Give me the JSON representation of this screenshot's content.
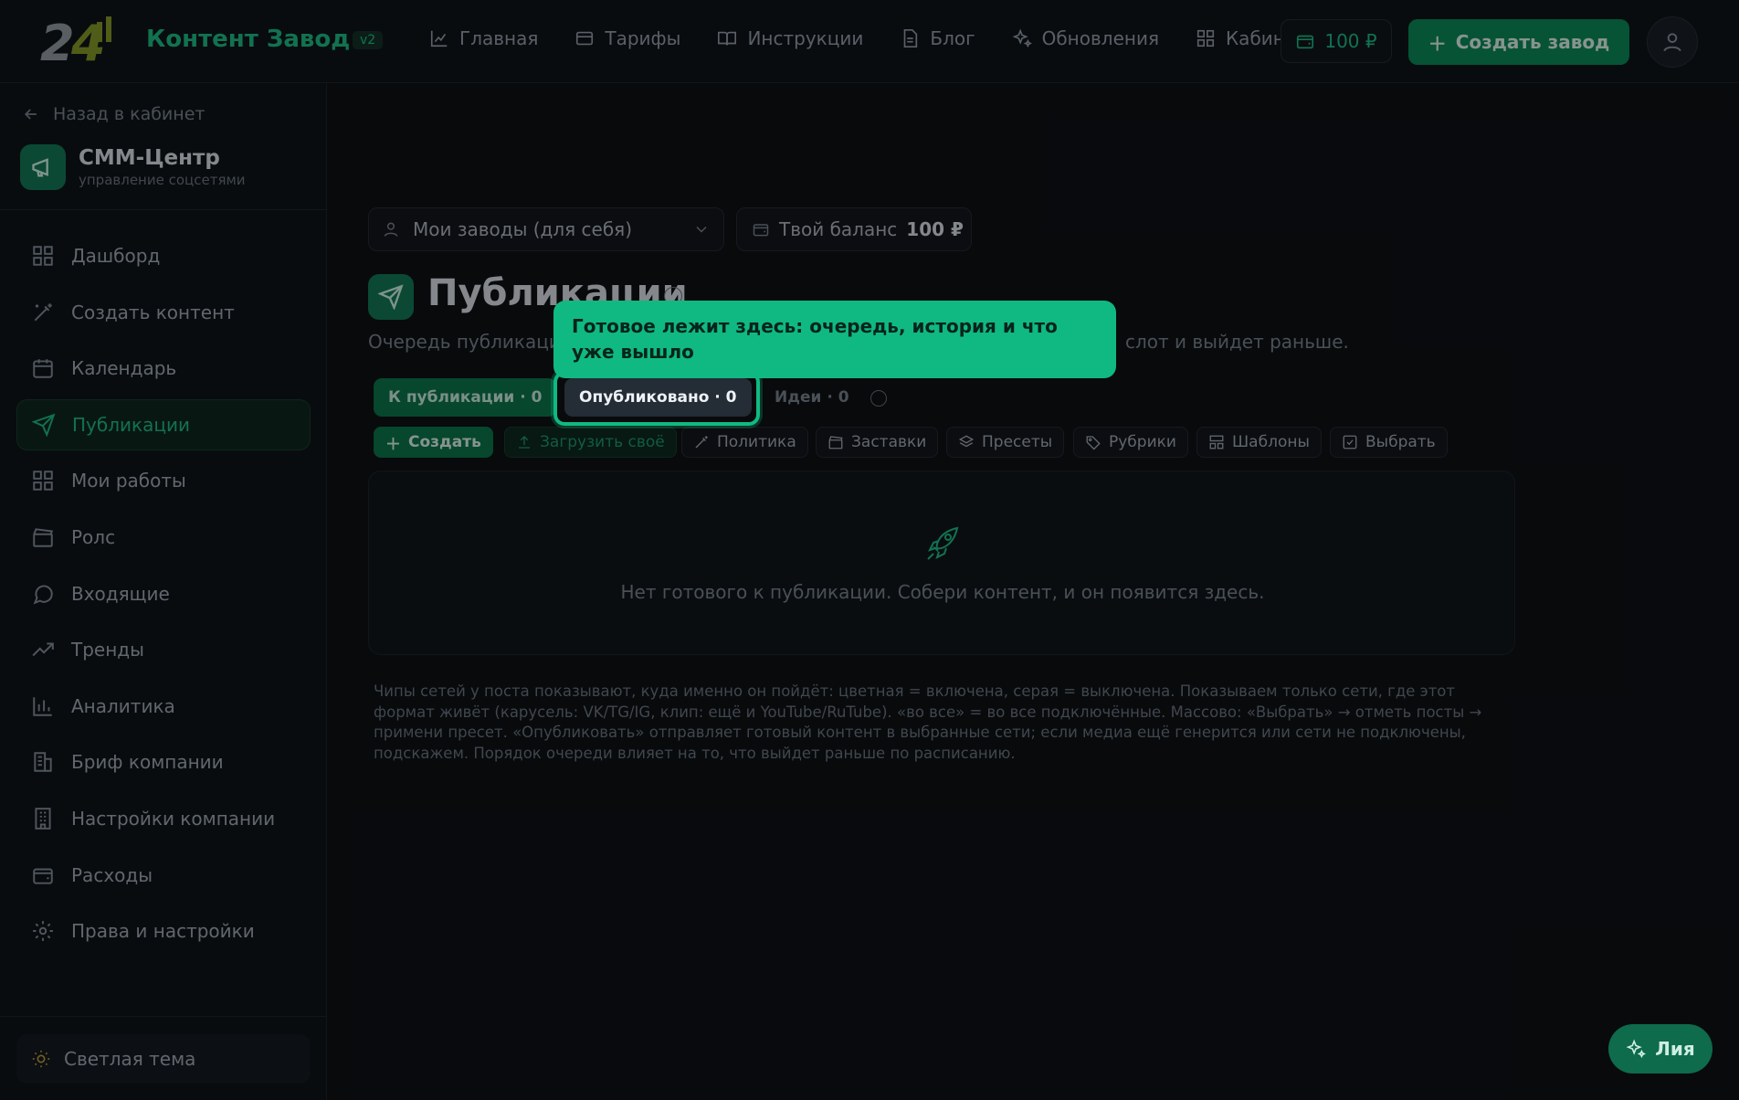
{
  "topbar": {
    "brand": "Контент Завод",
    "version": "v2",
    "nav": [
      {
        "label": "Главная",
        "icon": "chart-icon"
      },
      {
        "label": "Тарифы",
        "icon": "card-icon"
      },
      {
        "label": "Инструкции",
        "icon": "book-icon"
      },
      {
        "label": "Блог",
        "icon": "doc-icon"
      },
      {
        "label": "Обновления",
        "icon": "sparkles-icon"
      },
      {
        "label": "Кабинет",
        "icon": "grid-icon"
      }
    ],
    "balance": "100 ₽",
    "create_factory": "Создать завод"
  },
  "sidebar": {
    "back": "Назад в кабинет",
    "section_title": "СММ-Центр",
    "section_sub": "управление соцсетями",
    "items": [
      {
        "label": "Дашборд",
        "icon": "grid-icon"
      },
      {
        "label": "Создать контент",
        "icon": "magic-wand-icon"
      },
      {
        "label": "Календарь",
        "icon": "calendar-icon"
      },
      {
        "label": "Публикации",
        "icon": "send-icon",
        "active": true
      },
      {
        "label": "Мои работы",
        "icon": "grid-icon"
      },
      {
        "label": "Ролс",
        "icon": "clapper-icon"
      },
      {
        "label": "Входящие",
        "icon": "chat-icon"
      },
      {
        "label": "Тренды",
        "icon": "trend-icon"
      },
      {
        "label": "Аналитика",
        "icon": "bar-chart-icon"
      },
      {
        "label": "Бриф компании",
        "icon": "building-icon"
      },
      {
        "label": "Настройки компании",
        "icon": "office-icon"
      },
      {
        "label": "Расходы",
        "icon": "wallet-icon"
      },
      {
        "label": "Права и настройки",
        "icon": "gear-icon"
      }
    ],
    "theme": "Светлая тема"
  },
  "main": {
    "selector": "Мои заводы (для себя)",
    "balance_label": "Твой баланс",
    "balance_value": "100 ₽",
    "title": "Публикации",
    "desc_left": "Очередь публикаци",
    "desc_right": "слот и выйдет раньше.",
    "tabs": {
      "queue": "К публикации · 0",
      "published": "Опубликовано · 0",
      "ideas": "Идеи · 0"
    },
    "toolbar": {
      "create": "Создать",
      "upload": "Загрузить своё",
      "policy": "Политика",
      "covers": "Заставки",
      "presets": "Пресеты",
      "rubrics": "Рубрики",
      "templates": "Шаблоны",
      "select": "Выбрать"
    },
    "empty": "Нет готового к публикации. Собери контент, и он появится здесь.",
    "help": "Чипы сетей у поста показывают, куда именно он пойдёт: цветная = включена, серая = выключена. Показываем только сети, где этот формат живёт (карусель: VK/TG/IG, клип: ещё и YouTube/RuTube). «во все» = во все подключённые. Массово: «Выбрать» → отметь посты → примени пресет. «Опубликовать» отправляет готовый контент в выбранные сети; если медиа ещё генерится или сети не подключены, подскажем. Порядок очереди влияет на то, что выйдет раньше по расписанию."
  },
  "tooltip": "Готовое лежит здесь: очередь, история и что уже вышло",
  "assistant": "Лия",
  "colors": {
    "accent": "#1fc48a",
    "tooltip": "#10b981",
    "background": "#0f1216"
  }
}
